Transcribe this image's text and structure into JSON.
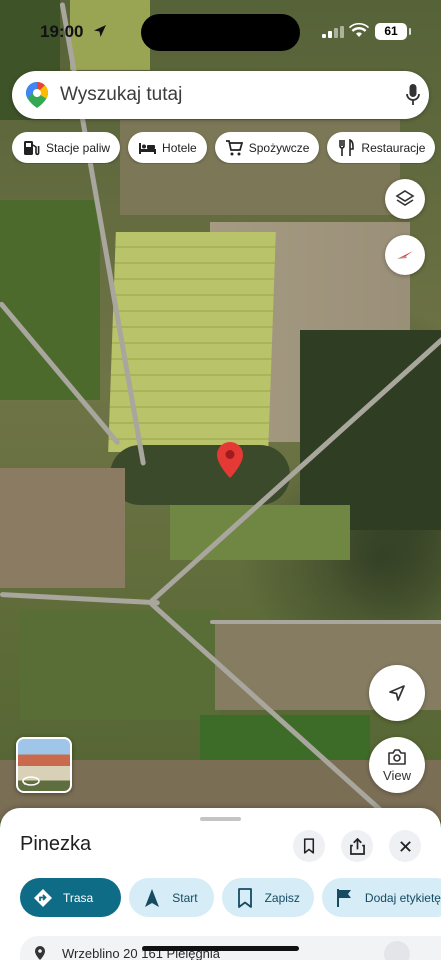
{
  "status_bar": {
    "time": "19:00",
    "battery": "61"
  },
  "search": {
    "placeholder": "Wyszukaj tutaj"
  },
  "chips": [
    {
      "label": "Stacje paliw",
      "icon": "gas-station-icon"
    },
    {
      "label": "Hotele",
      "icon": "bed-icon"
    },
    {
      "label": "Spożywcze",
      "icon": "cart-icon"
    },
    {
      "label": "Restauracje",
      "icon": "fork-knife-icon"
    }
  ],
  "map": {
    "view_label": "View"
  },
  "sheet": {
    "title": "Pinezka",
    "actions": [
      {
        "label": "Trasa",
        "icon": "directions-icon"
      },
      {
        "label": "Start",
        "icon": "navigation-arrow-icon"
      },
      {
        "label": "Zapisz",
        "icon": "bookmark-icon"
      },
      {
        "label": "Dodaj etykietę",
        "icon": "flag-icon"
      }
    ],
    "address": "Wrzeblino 20 161 Pielęgnia"
  },
  "colors": {
    "primary_action": "#0e6c86",
    "secondary_action_bg": "#d6ecf6",
    "pin": "#e53935"
  }
}
